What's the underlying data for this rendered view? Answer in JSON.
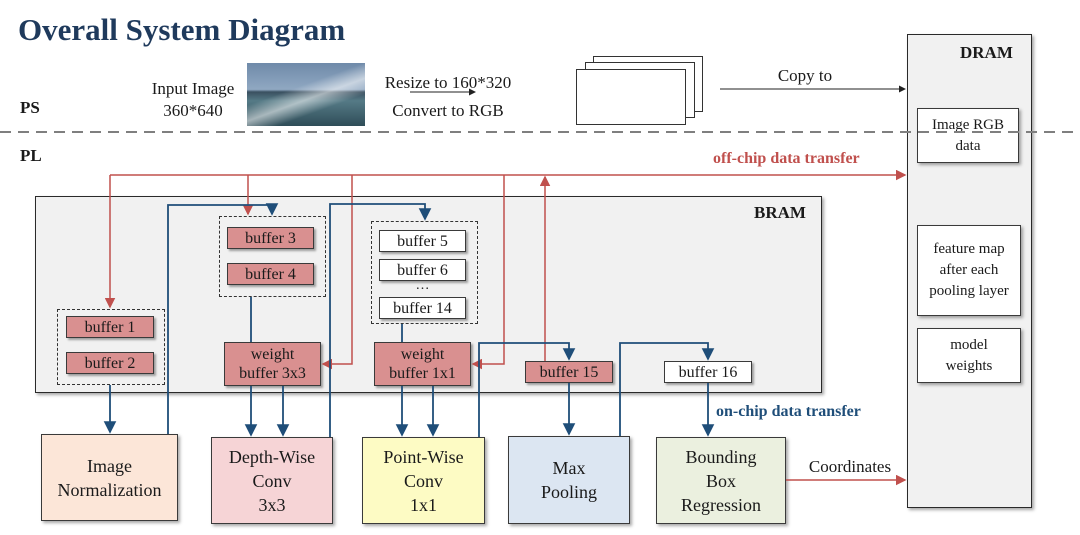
{
  "title": "Overall System Diagram",
  "regions": {
    "ps": "PS",
    "pl": "PL"
  },
  "ps": {
    "input_image_label": "Input Image",
    "input_image_size": "360*640",
    "input_image_icon": "boat-photo-thumbnail",
    "resize_label": "Resize to 160*320",
    "convert_label": "Convert to RGB",
    "copy_label": "Copy to",
    "frames_icon": "stacked-frames"
  },
  "dram": {
    "title": "DRAM",
    "items": [
      "Image RGB data",
      "feature map after each pooling layer",
      "model weights"
    ]
  },
  "bram": {
    "title": "BRAM",
    "buffers": {
      "b1": "buffer 1",
      "b2": "buffer 2",
      "b3": "buffer 3",
      "b4": "buffer 4",
      "b5": "buffer 5",
      "b6": "buffer 6",
      "ellipsis": "…",
      "b14": "buffer 14",
      "w33_line1": "weight",
      "w33_line2": "buffer 3x3",
      "w11_line1": "weight",
      "w11_line2": "buffer 1x1",
      "b15": "buffer 15",
      "b16": "buffer 16"
    }
  },
  "blocks": {
    "norm": {
      "line1": "Image",
      "line2": "Normalization",
      "color": "#fce6d8"
    },
    "dw": {
      "line1": "Depth-Wise",
      "line2": "Conv",
      "line3": "3x3",
      "color": "#f6d4d6"
    },
    "pw": {
      "line1": "Point-Wise",
      "line2": "Conv",
      "line3": "1x1",
      "color": "#fdfbc4"
    },
    "mp": {
      "line1": "Max",
      "line2": "Pooling",
      "color": "#dce6f2"
    },
    "bb": {
      "line1": "Bounding",
      "line2": "Box",
      "line3": "Regression",
      "color": "#ebf0df"
    }
  },
  "labels": {
    "off_chip": "off-chip data transfer",
    "on_chip": "on-chip data transfer",
    "coordinates": "Coordinates"
  },
  "colors": {
    "off_chip": "#c0504d",
    "on_chip": "#1f4e79",
    "buffer_red": "#d99090",
    "panel": "#f1f1f1",
    "title": "#1f3a5c"
  }
}
